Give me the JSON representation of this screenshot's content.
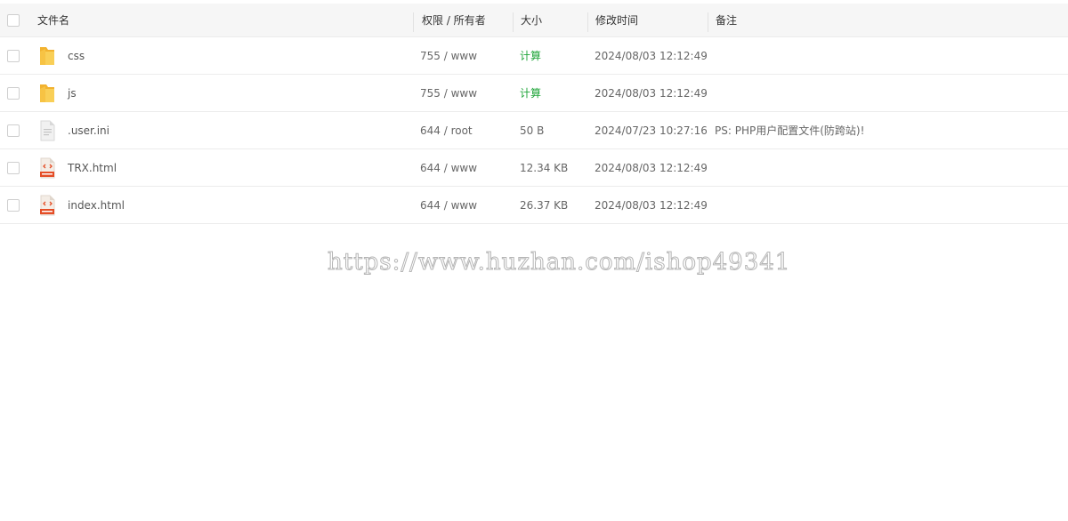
{
  "header": {
    "name": "文件名",
    "perm": "权限 / 所有者",
    "size": "大小",
    "time": "修改时间",
    "note": "备注"
  },
  "rows": [
    {
      "name": "css",
      "icon": "folder-icon",
      "perm": "755 / www",
      "size": "计算",
      "time": "2024/08/03 12:12:49",
      "note": ""
    },
    {
      "name": "js",
      "icon": "folder-icon",
      "perm": "755 / www",
      "size": "计算",
      "time": "2024/08/03 12:12:49",
      "note": ""
    },
    {
      "name": ".user.ini",
      "icon": "text-file-icon",
      "perm": "644 / root",
      "size": "50 B",
      "time": "2024/07/23 10:27:16",
      "note": "PS: PHP用户配置文件(防跨站)!"
    },
    {
      "name": "TRX.html",
      "icon": "html-file-icon",
      "perm": "644 / www",
      "size": "12.34 KB",
      "time": "2024/08/03 12:12:49",
      "note": ""
    },
    {
      "name": "index.html",
      "icon": "html-file-icon",
      "perm": "644 / www",
      "size": "26.37 KB",
      "time": "2024/08/03 12:12:49",
      "note": ""
    }
  ],
  "watermark": "https://www.huzhan.com/ishop49341",
  "colors": {
    "link_green": "#20a53a",
    "folder_yellow": "#f7c344",
    "html_red": "#e44d26",
    "header_bg": "#f6f6f6"
  }
}
